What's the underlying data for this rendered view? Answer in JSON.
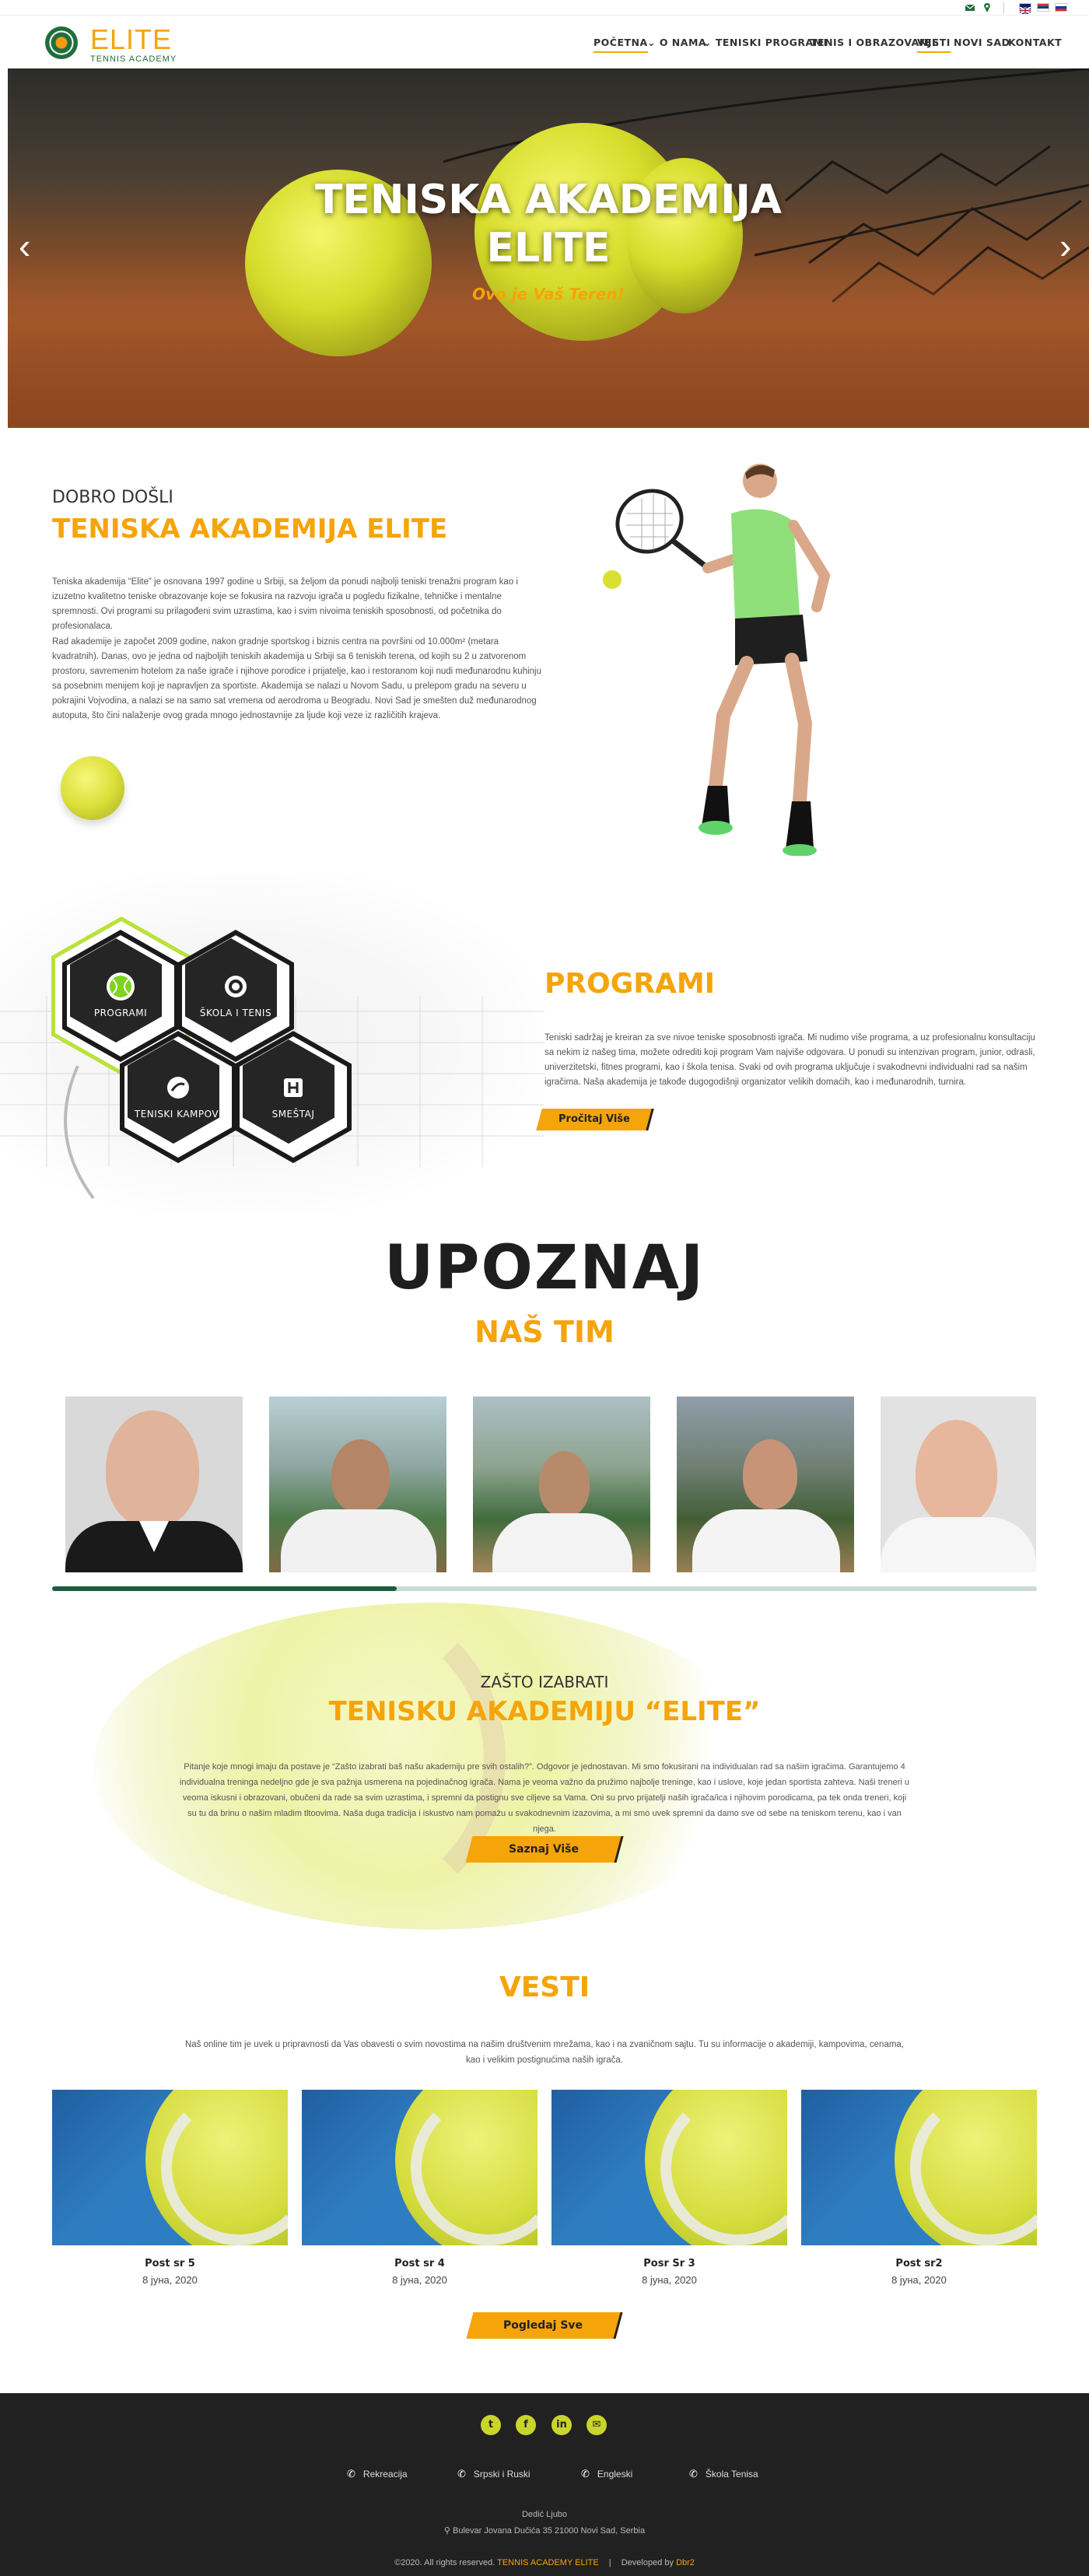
{
  "topbar": {
    "email_icon": "envelope-icon",
    "location_icon": "map-marker-icon",
    "flags": [
      "en",
      "sr-latin",
      "ru"
    ]
  },
  "header": {
    "logo_title": "ELITE",
    "logo_subtitle": "TENNIS ACADEMY",
    "nav": [
      {
        "label": "POČETNA",
        "active": true
      },
      {
        "label": "O NAMA",
        "dropdown": true
      },
      {
        "label": "TENISKI PROGRAMI",
        "dropdown": true
      },
      {
        "label": "TENIS I OBRAZOVANJE"
      },
      {
        "label": "VESTI"
      },
      {
        "label": "NOVI SAD"
      },
      {
        "label": "KONTAKT"
      }
    ]
  },
  "hero": {
    "title_line1": "TENISKA AKADEMIJA",
    "title_line2": "ELITE",
    "subtitle": "Ovo je Vaš Teren!"
  },
  "welcome": {
    "kicker": "DOBRO DOŠLI",
    "title": "TENISKA AKADEMIJA ELITE",
    "para1": "Teniska akademija “Elite” je osnovana 1997 godine u Srbiji, sa željom da ponudi najbolji teniski trenažni program kao i izuzetno kvalitetno teniske obrazovanje koje se fokusira na razvoju igrača u pogledu fizikalne, tehničke i mentalne spremnosti. Ovi programi su prilagođeni svim uzrastima, kao i svim nivoima teniskih sposobnosti, od početnika do profesionalaca.",
    "para2": "Rad akademije je započet 2009 godine, nakon gradnje sportskog i biznis centra na površini od 10.000m² (metara kvadratnih). Danas, ovo je jedna od najboljih teniskih akademija u Srbiji sa 6 teniskih terena, od kojih su 2 u zatvorenom prostoru, savremenim hotelom za naše igrače i njihove porodice i prijatelje, kao i restoranom koji nudi međunarodnu kuhinju sa posebnim menijem koji je napravljen za sportiste. Akademija se nalazi u Novom Sadu, u prelepom gradu na severu u pokrajini Vojvodina, a nalazi se na samo sat vremena od aerodroma u Beogradu. Novi Sad je smešten duž međunarodnog autoputa, što čini nalaženje ovog grada mnogo jednostavnije za ljude koji veze iz različitih krajeva."
  },
  "programs": {
    "hexes": [
      {
        "label": "PROGRAMI",
        "icon": "tennis-ball-icon"
      },
      {
        "label": "ŠKOLA I TENIS",
        "icon": "target-icon"
      },
      {
        "label": "TENISKI KAMPOVI",
        "icon": "ball-icon"
      },
      {
        "label": "SMEŠTAJ",
        "icon": "hotel-icon"
      }
    ],
    "title": "PROGRAMI",
    "text": "Teniski sadržaj je kreiran za sve nivoe teniske sposobnosti igrača. Mi nudimo više programa, a uz profesionalnu konsultaciju sa nekim iz našeg tima, možete odrediti koji program Vam najviše odgovara. U ponudi su intenzivan program, junior, odrasli, univerzitetski, fitnes programi, kao i škola tenisa. Svaki od ovih programa uključuje i svakodnevni individualni rad sa našim igračima. Naša akademija je takođe dugogodišnji organizator velikih domaćih, kao i međunarodnih, turnira.",
    "button": "Pročitaj Više"
  },
  "team": {
    "title": "UPOZNAJ",
    "subtitle": "NAŠ TIM",
    "progress_fraction": 0.35
  },
  "why": {
    "kicker": "ZAŠTO IZABRATI",
    "title": "TENISKU AKADEMIJU “ELITE”",
    "text": "Pitanje koje mnogi imaju da postave je “Zašto izabrati baš našu akademiju pre svih ostalih?”. Odgovor je jednostavan. Mi smo fokusirani na individualan rad sa našim igračima. Garantujemo 4 individualna treninga nedeljno gde je sva pažnja usmerena na pojedinačnog igrača. Nama je veoma važno da pružimo najbolje treninge, kao i uslove, koje jedan sportista zahteva. Naši treneri u veoma iskusni i obrazovani, obučeni da rade sa svim uzrastima, i spremni da postignu sve ciljeve sa Vama. Oni su prvo prijatelji naših igrača/ica i njihovim porodicama, pa tek onda treneri, koji su tu da brinu o našim mladim tltoovima. Naša duga tradicija i iskustvo nam pomažu u svakodnevnim izazovima, a mi smo uvek spremni da damo sve od sebe na teniskom terenu, kao i van njega.",
    "button": "Saznaj Više"
  },
  "news": {
    "title": "VESTI",
    "intro": "Naš online tim je uvek u pripravnosti da Vas obavesti o svim novostima na našim društvenim mrežama, kao i na zvaničnom sajtu. Tu su informacije o akademiji, kampovima, cenama, kao i velikim postignućima naših igrača.",
    "posts": [
      {
        "title": "Post sr 5",
        "date": "8 јуна, 2020"
      },
      {
        "title": "Post sr 4",
        "date": "8 јуна, 2020"
      },
      {
        "title": "Posr Sr 3",
        "date": "8 јуна, 2020"
      },
      {
        "title": "Post sr2",
        "date": "8 јуна, 2020"
      }
    ],
    "button": "Pogledaj Sve"
  },
  "footer": {
    "social": [
      "twitter-icon",
      "facebook-icon",
      "linkedin-icon",
      "email-icon"
    ],
    "links": [
      "Rekreacija",
      "Srpski i Ruski",
      "Engleski",
      "Škola Tenisa"
    ],
    "name": "Dedić Ljubo",
    "address": "Bulevar Jovana Dučića 35 21000 Novi Sad, Serbia",
    "copyright_prefix": "©2020. All rights reserved.",
    "copyright_brand": "TENNIS ACADEMY ELITE",
    "developed_by": "Developed by",
    "developer": "Dbr2"
  },
  "colors": {
    "accent": "#f5a40a",
    "brand_green": "#1f6e3c",
    "footer_bg": "#212121",
    "social_green": "#c9d52a"
  }
}
